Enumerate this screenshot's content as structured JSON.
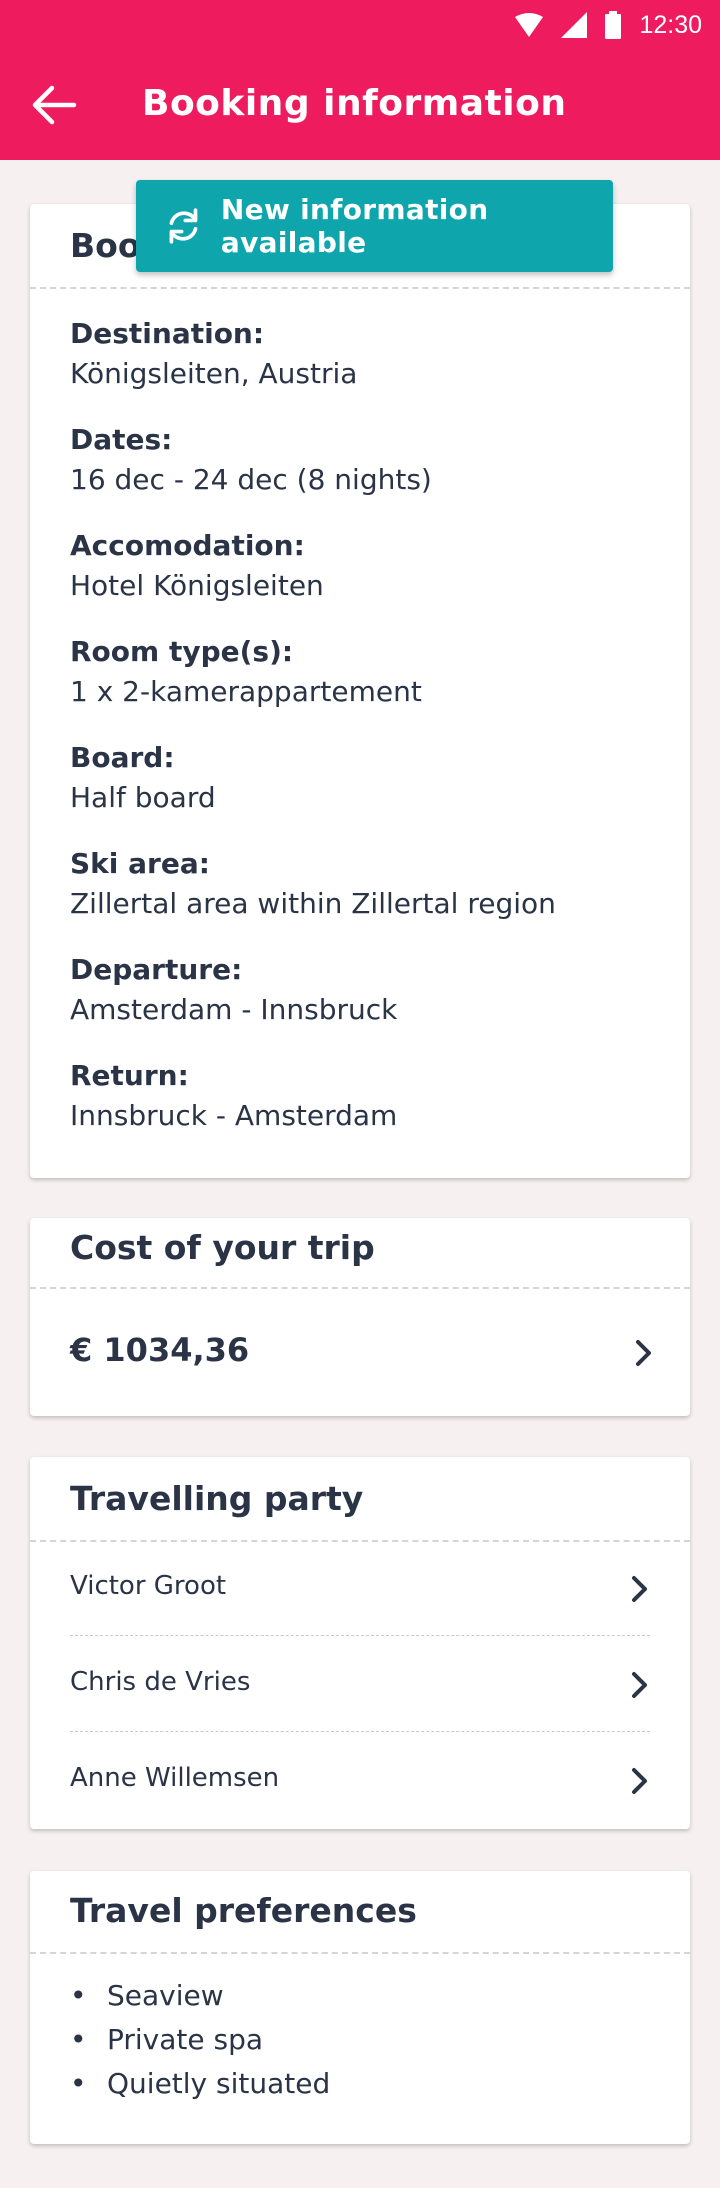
{
  "status_bar": {
    "time": "12:30"
  },
  "app_bar": {
    "title": "Booking information"
  },
  "toast": {
    "label": "New information available"
  },
  "booking_card": {
    "title_visible": "Bool",
    "fields": [
      {
        "label": "Destination:",
        "value": "Königsleiten, Austria"
      },
      {
        "label": "Dates:",
        "value": "16 dec - 24 dec (8 nights)"
      },
      {
        "label": "Accomodation:",
        "value": "Hotel Königsleiten"
      },
      {
        "label": "Room type(s):",
        "value": "1 x 2-kamerappartement"
      },
      {
        "label": "Board:",
        "value": "Half board"
      },
      {
        "label": "Ski area:",
        "value": "Zillertal area within Zillertal region"
      },
      {
        "label": "Departure:",
        "value": "Amsterdam - Innsbruck"
      },
      {
        "label": "Return:",
        "value": "Innsbruck - Amsterdam"
      }
    ]
  },
  "cost_card": {
    "title": "Cost of your trip",
    "amount": "€ 1034,36"
  },
  "party_card": {
    "title": "Travelling party",
    "members": [
      "Victor Groot",
      "Chris de Vries",
      "Anne Willemsen"
    ]
  },
  "preferences_card": {
    "title": "Travel preferences",
    "items": [
      "Seaview",
      "Private spa",
      "Quietly situated"
    ]
  },
  "colors": {
    "brand": "#ee1b5f",
    "toast": "#0ea5ad",
    "text": "#2a3446",
    "background": "#f6f1f0"
  },
  "icons": [
    "wifi-icon",
    "signal-icon",
    "battery-icon",
    "back-arrow-icon",
    "refresh-icon",
    "chevron-right-icon"
  ]
}
